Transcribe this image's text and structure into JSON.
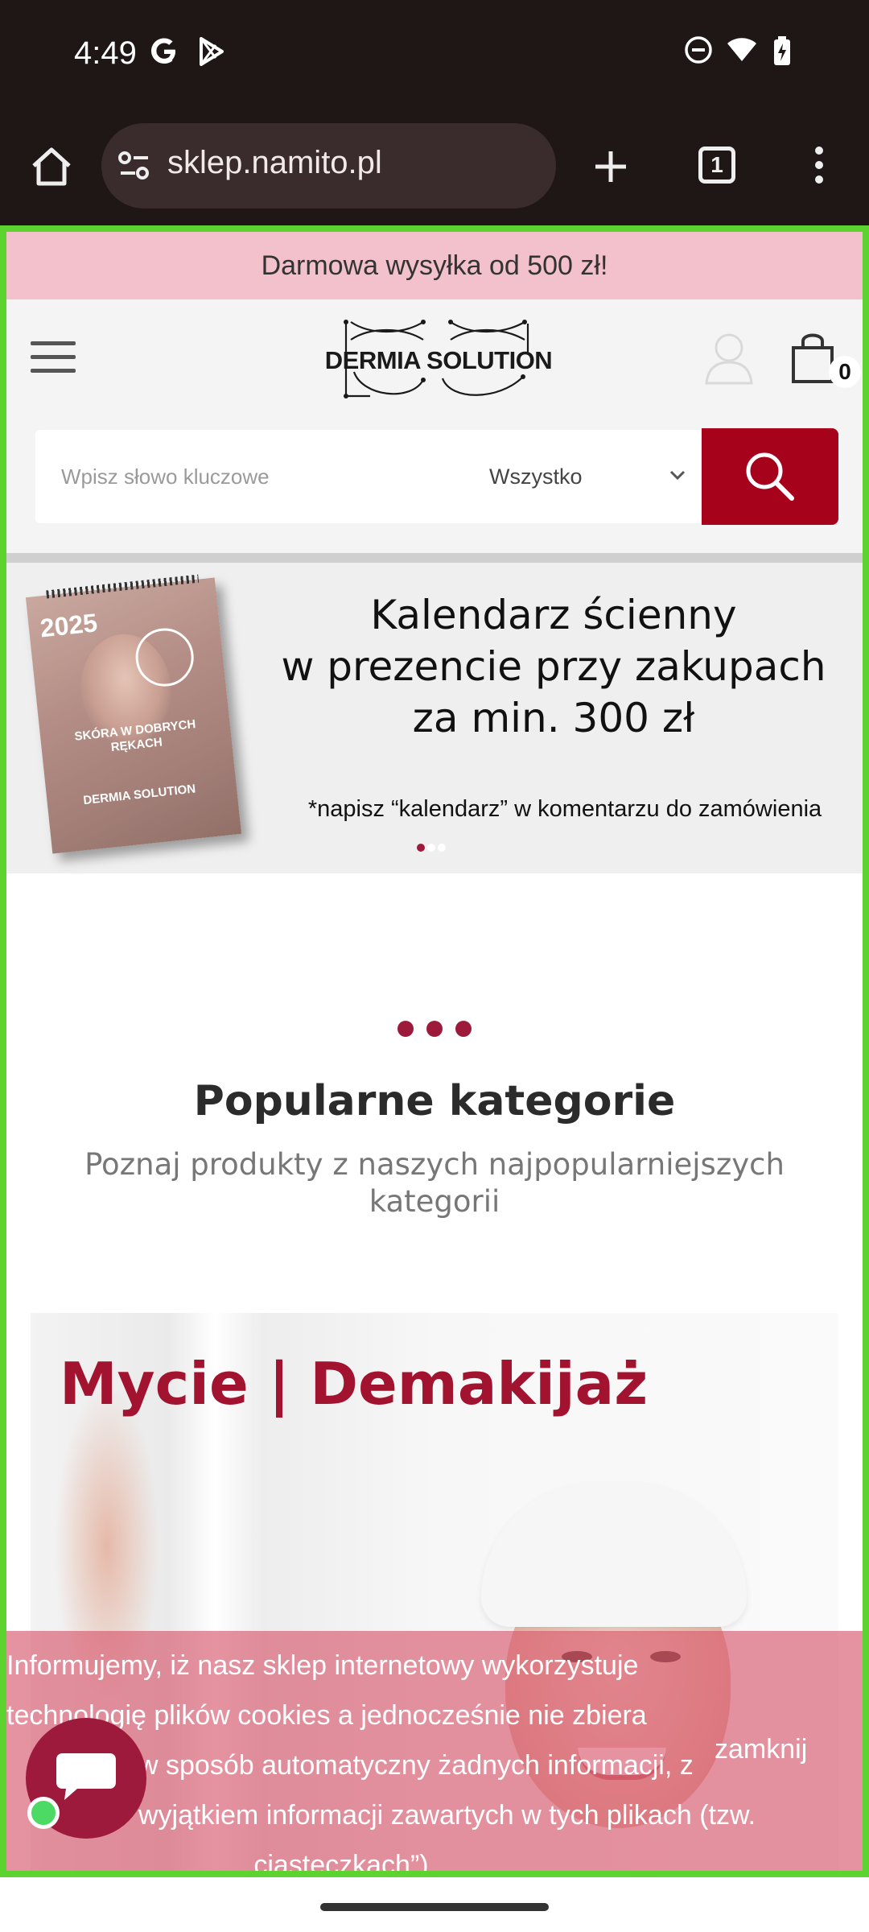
{
  "status_bar": {
    "time": "4:49",
    "left_icons": [
      "google-icon",
      "play-store-icon"
    ],
    "right_icons": [
      "do-not-disturb-icon",
      "wifi-icon",
      "battery-charging-icon"
    ]
  },
  "browser": {
    "url": "sklep.namito.pl",
    "tab_count": "1",
    "icons": [
      "home-icon",
      "site-info-icon",
      "new-tab-icon",
      "tab-switcher-icon",
      "menu-dots-icon"
    ]
  },
  "page": {
    "promo_bar": "Darmowa wysyłka od 500 zł!",
    "header": {
      "logo_text": "DERMIA SOLUTION",
      "cart_count": "0"
    },
    "search": {
      "placeholder": "Wpisz słowo kluczowe",
      "category": "Wszystko"
    },
    "banner": {
      "calendar_year": "2025",
      "calendar_caption": "SKÓRA W DOBRYCH RĘKACH",
      "calendar_brand": "DERMIA SOLUTION",
      "line1": "Kalendarz ścienny",
      "line2": "w prezencie przy zakupach",
      "line3": "za min. 300 zł",
      "note": "*napisz “kalendarz” w komentarzu do zamówienia",
      "slide_count": 3,
      "active_slide": 1
    },
    "popular": {
      "title": "Popularne kategorie",
      "subtitle": "Poznaj produkty z naszych najpopularniejszych kategorii"
    },
    "category_card": {
      "title": "Mycie | Demakijaż"
    },
    "cookie": {
      "lines": [
        "Informujemy, iż nasz sklep internetowy wykorzystuje",
        "technologię plików cookies a jednocześnie nie zbiera",
        "w sposób automatyczny żadnych informacji, z",
        "wyjątkiem informacji zawartych w tych plikach (tzw.",
        "„ciasteczkach”)."
      ],
      "close_label": "zamknij"
    }
  },
  "colors": {
    "brand": "#a6021b",
    "promo_bg": "#f3c1cb",
    "accent_dots": "#9e1a3b",
    "viewport_border": "#5cd32e"
  }
}
